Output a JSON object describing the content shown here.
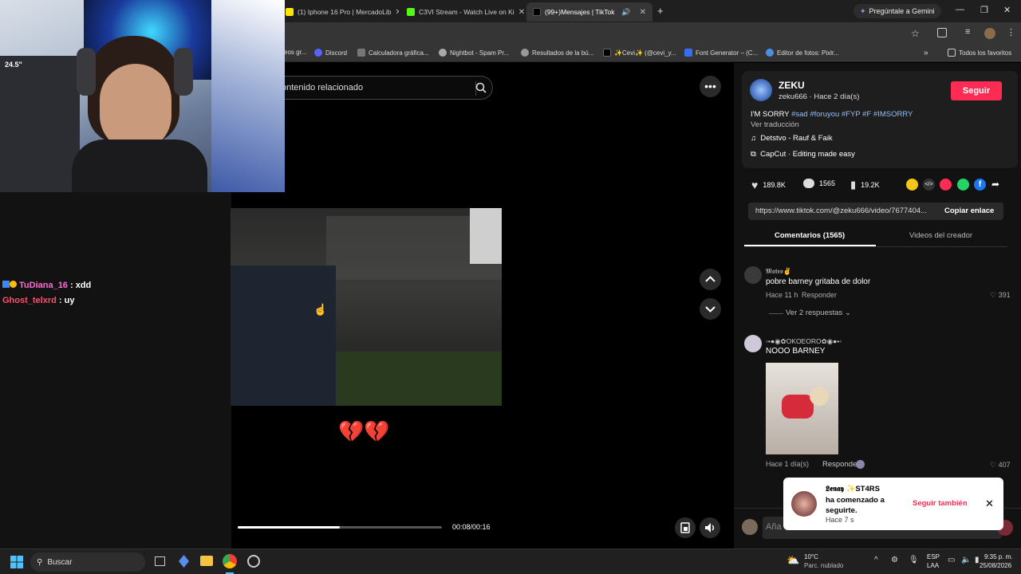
{
  "browser": {
    "tabs": [
      {
        "label": "(1) Iphone 16 Pro | MercadoLib",
        "active": false
      },
      {
        "label": "C3VI Stream - Watch Live on Ki",
        "active": false
      },
      {
        "label": "(99+)Mensajes | TikTok",
        "active": true
      }
    ],
    "new_tab": "+",
    "gemini_label": "Pregúntale a Gemini",
    "bookmarks": [
      "eos gr...",
      "Discord",
      "Calculadora gráfica...",
      "Nightbot - Spam Pr...",
      "Resultados de la bú...",
      "✨Cevi✨ (@cevi_y...",
      "Font Generator – (C...",
      "Editor de fotos: Pixlr...",
      "»",
      "Todos los favoritos"
    ]
  },
  "chat": [
    {
      "user": "TuDiana_16",
      "message": ": xdd",
      "color": "#ff6ad5"
    },
    {
      "user": "Ghost_telxrd",
      "message": ": uy",
      "color": "#ff4d6d"
    }
  ],
  "video": {
    "search_placeholder": "ontenido relacionado",
    "caption_emoji": "💔💔",
    "time": "00:08/00:16",
    "progress": 0.5
  },
  "post": {
    "display_name": "ZEKU",
    "handle_line": "zeku666 · Hace 2 día(s)",
    "follow_label": "Seguir",
    "caption_prefix": "I'M SORRY ",
    "hashtags": "#sad #foruyou #FYP #F #IMSORRY",
    "translate": "Ver traducción",
    "music": "Detstvo - Rauf & Faik",
    "capcut": "CapCut · Editing made easy",
    "likes": "189.8K",
    "comments": "1565",
    "saves": "19.2K",
    "link": "https://www.tiktok.com/@zeku666/video/7677404...",
    "copy_link": "Copiar enlace",
    "tab_comments": "Comentarios (1565)",
    "tab_creator": "Videos del creador"
  },
  "comments": [
    {
      "user": "𝕸𝖆𝖙𝖊𝖔✌",
      "text": "pobre barney gritaba de dolor",
      "time": "Hace 11 h",
      "reply": "Responder",
      "likes": "391",
      "replies": "Ver 2 respuestas"
    },
    {
      "user": "◦•●◉✿OKOEORO✿◉●•◦",
      "text": "NOOO BARNEY",
      "time": "Hace 1 día(s)",
      "reply": "Responder",
      "likes": "407"
    }
  ],
  "toast": {
    "name": "𝕷𝖊𝖓𝖆𝖞 ✨ST4RS",
    "message": "ha comenzado a seguirte.",
    "time": "Hace 7 s",
    "action": "Seguir también"
  },
  "comment_input_placeholder": "Aña",
  "taskbar": {
    "search": "Buscar",
    "weather_temp": "10°C",
    "weather_desc": "Parc. nublado",
    "lang": "ESP",
    "lang2": "LAA",
    "time": "9:35 p. m.",
    "date": "25/08/2026"
  }
}
